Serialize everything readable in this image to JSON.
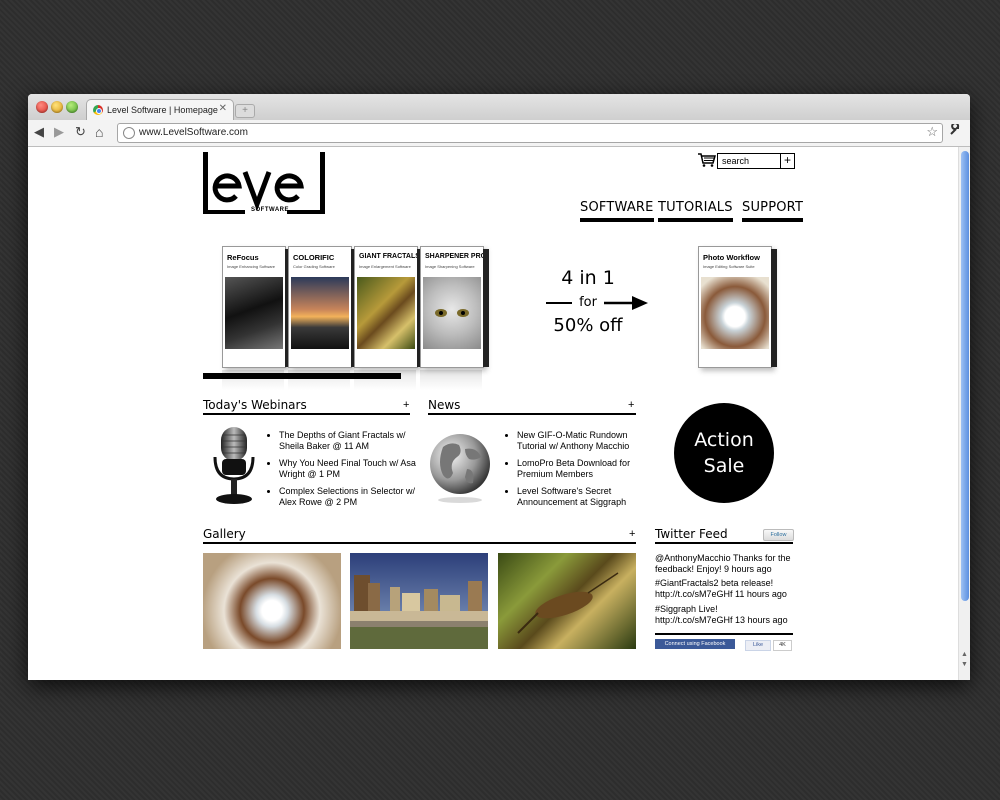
{
  "browser": {
    "tab_title": "Level Software | Homepage",
    "tab_close": "✕",
    "new_tab": "+",
    "url": "www.LevelSoftware.com",
    "back": "◀",
    "forward": "▶",
    "reload": "↻",
    "home": "⌂",
    "bookmark_star": "☆",
    "wrench": "🔧"
  },
  "header": {
    "logo_word": "Level",
    "logo_sub": "SOFTWARE",
    "search_value": "search",
    "search_plus": "+",
    "nav": [
      {
        "label": "SOFTWARE"
      },
      {
        "label": "TUTORIALS"
      },
      {
        "label": "SUPPORT"
      }
    ]
  },
  "promo": {
    "boxes": [
      {
        "name": "ReFocus",
        "sub": "Image Enhancing Software"
      },
      {
        "name": "COLORIFIC",
        "sub": "Color Grading Software"
      },
      {
        "name": "GIANT FRACTALS",
        "sub": "Image Enlargement Software"
      },
      {
        "name": "SHARPENER PRO",
        "sub": "Image Sharpening Software"
      }
    ],
    "offer_line1": "4 in 1",
    "offer_line2": "for",
    "offer_line3": "50% off",
    "bundle_name": "Photo Workflow",
    "bundle_sub": "Image Editing Software Suite"
  },
  "webinars": {
    "heading": "Today's Webinars",
    "plus": "+",
    "items": [
      "The Depths of Giant Fractals w/ Sheila Baker @ 11 AM",
      "Why You Need Final Touch w/ Asa Wright @ 1 PM",
      "Complex Selections in Selector w/ Alex Rowe @ 2 PM"
    ]
  },
  "news": {
    "heading": "News",
    "plus": "+",
    "items": [
      "New GIF-O-Matic Rundown Tutorial w/ Anthony Macchio",
      "LomoPro Beta Download for Premium Members",
      "Level Software's Secret Announcement at Siggraph"
    ]
  },
  "action_sale": {
    "line1": "Action",
    "line2": "Sale"
  },
  "gallery": {
    "heading": "Gallery",
    "plus": "+"
  },
  "twitter": {
    "heading": "Twitter Feed",
    "follow": "Follow",
    "tweets": [
      {
        "handle": "@AnthonyMacchio",
        "text": "Thanks for the feedback! Enjoy! 9 hours ago"
      },
      {
        "handle": "#GiantFractals2",
        "text": "beta release! http://t.co/sM7eGHf 11 hours ago"
      },
      {
        "handle": "#Siggraph",
        "text": "Live! http://t.co/sM7eGHf 13 hours ago"
      }
    ],
    "fb_connect": "Connect using Facebook",
    "fb_like": "Like",
    "fb_count": "4K"
  },
  "colors": {
    "accent": "#000000",
    "facebook": "#3b5998",
    "scroll_thumb": "#6f9de8"
  }
}
